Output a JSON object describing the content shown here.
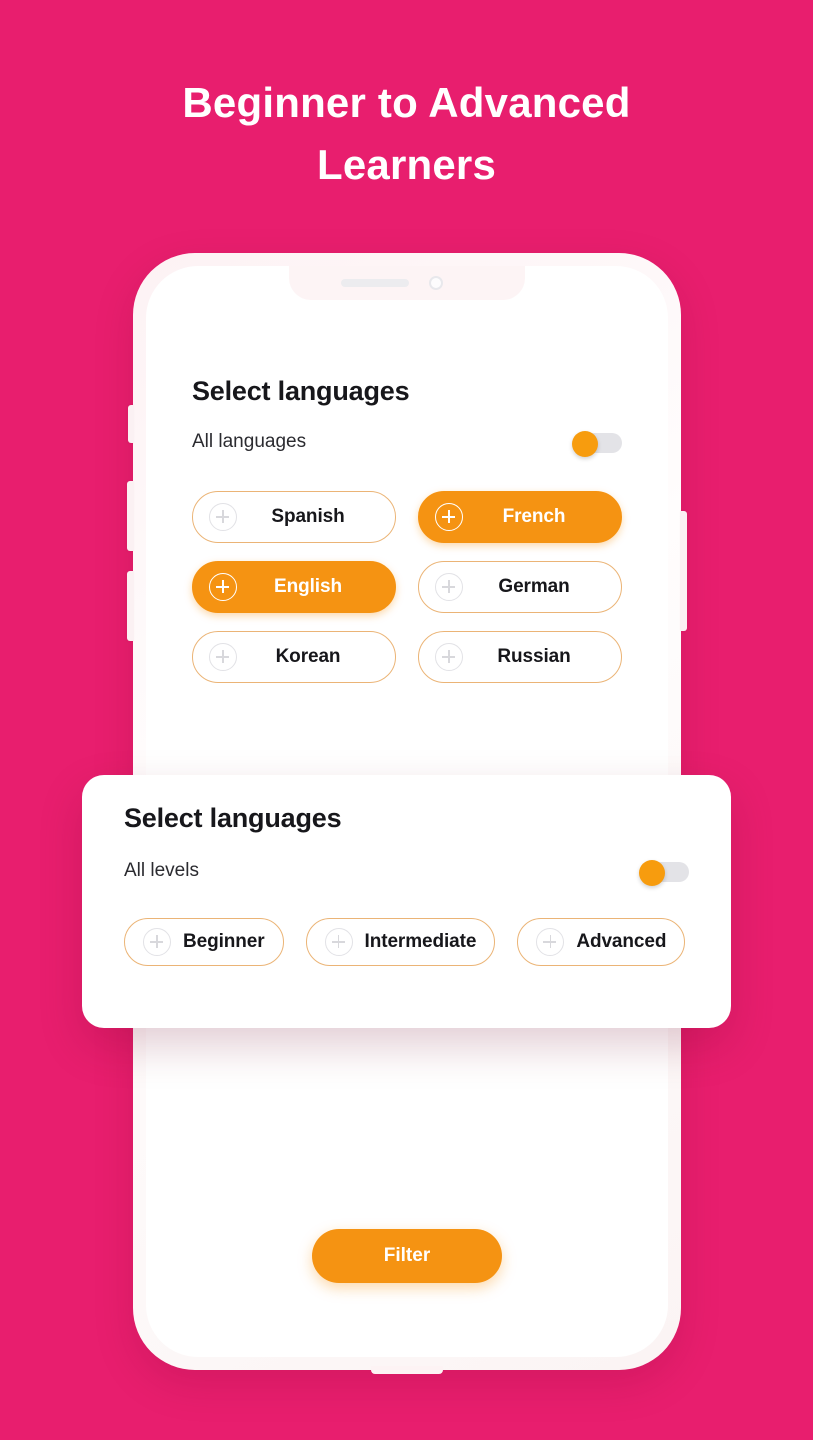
{
  "theme": {
    "background": "#E81E6E",
    "accent": "#F59312",
    "chip_border": "#EBB476",
    "text_dark": "#17171b",
    "white": "#ffffff"
  },
  "headline": "Beginner to Advanced Learners",
  "phone": {
    "notch": {
      "speaker": "speaker-bar",
      "camera": "front-camera"
    },
    "side_buttons": [
      "silent-switch",
      "volume-up",
      "volume-down",
      "power"
    ]
  },
  "language_panel": {
    "title": "Select languages",
    "toggle_label": "All languages",
    "toggle_state": "on",
    "chips": [
      {
        "label": "Spanish",
        "active": false,
        "icon": "plus-circle-icon"
      },
      {
        "label": "French",
        "active": true,
        "icon": "plus-circle-icon"
      },
      {
        "label": "English",
        "active": true,
        "icon": "plus-circle-icon"
      },
      {
        "label": "German",
        "active": false,
        "icon": "plus-circle-icon"
      },
      {
        "label": "Korean",
        "active": false,
        "icon": "plus-circle-icon"
      },
      {
        "label": "Russian",
        "active": false,
        "icon": "plus-circle-icon"
      }
    ]
  },
  "level_panel": {
    "title": "Select languages",
    "toggle_label": "All levels",
    "toggle_state": "on",
    "chips": [
      {
        "label": "Beginner",
        "active": false,
        "icon": "plus-circle-icon"
      },
      {
        "label": "Intermediate",
        "active": false,
        "icon": "plus-circle-icon"
      },
      {
        "label": "Advanced",
        "active": false,
        "icon": "plus-circle-icon"
      }
    ]
  },
  "filter_button": {
    "label": "Filter"
  }
}
